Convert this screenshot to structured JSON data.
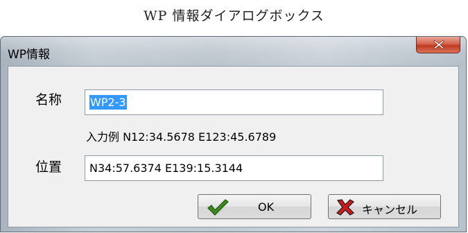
{
  "caption": "WP 情報ダイアログボックス",
  "window": {
    "title": "WP情報",
    "close_icon": "close-icon"
  },
  "form": {
    "name_label": "名称",
    "name_value": "WP2-3",
    "hint": "入力例 N12:34.5678 E123:45.6789",
    "position_label": "位置",
    "position_value": "N34:57.6374 E139:15.3144"
  },
  "buttons": {
    "ok_label": "OK",
    "ok_icon": "checkmark-icon",
    "cancel_label": "キャンセル",
    "cancel_icon": "x-mark-icon"
  },
  "colors": {
    "selection": "#3399ff",
    "close_button": "#c0391f",
    "ok_check": "#3c8a1e",
    "cancel_x": "#cc1a1a"
  }
}
